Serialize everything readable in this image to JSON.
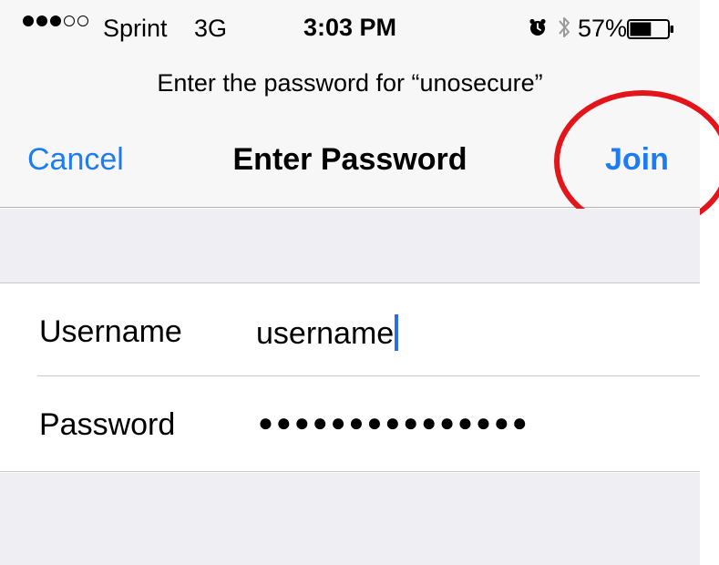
{
  "status_bar": {
    "signal_bars_filled": 3,
    "signal_bars_total": 5,
    "carrier": "Sprint",
    "network": "3G",
    "time": "3:03 PM",
    "battery_percent_label": "57%",
    "battery_level": 0.57,
    "icons": [
      "alarm-icon",
      "bluetooth-icon",
      "battery-icon"
    ]
  },
  "header": {
    "prompt": "Enter the password for “unosecure”",
    "cancel_label": "Cancel",
    "title": "Enter Password",
    "join_label": "Join"
  },
  "form": {
    "username_label": "Username",
    "username_value": "username",
    "password_label": "Password",
    "password_value": "●●●●●●●●●●●●●●●"
  },
  "colors": {
    "accent": "#1e7cf2",
    "annotation": "#e3141a",
    "cursor": "#2a6cf0"
  }
}
